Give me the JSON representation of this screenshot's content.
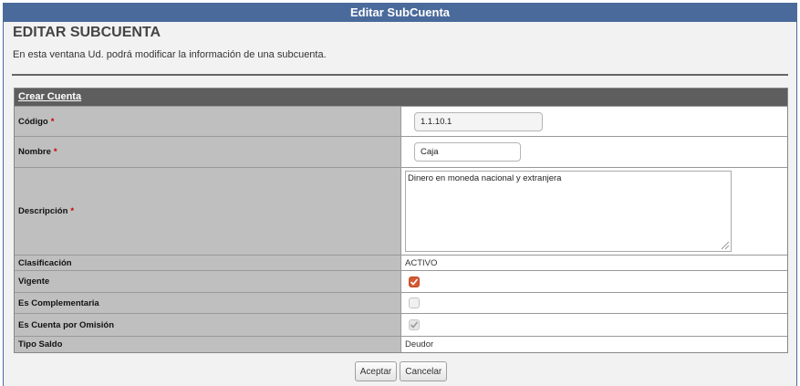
{
  "window": {
    "title": "Editar SubCuenta"
  },
  "page": {
    "heading": "EDITAR SUBCUENTA",
    "description": "En esta ventana Ud. podrá modificar la información de una subcuenta."
  },
  "form": {
    "section_title": "Crear Cuenta",
    "required_mark": "*",
    "codigo": {
      "label": "Código",
      "value": "1.1.10.1"
    },
    "nombre": {
      "label": "Nombre",
      "value": "Caja"
    },
    "descripcion": {
      "label": "Descripción",
      "value": "Dinero en moneda nacional y extranjera"
    },
    "clasificacion": {
      "label": "Clasificación",
      "value": "ACTIVO"
    },
    "vigente": {
      "label": "Vigente",
      "checked": true
    },
    "complementaria": {
      "label": "Es Complementaria",
      "checked": false
    },
    "omision": {
      "label": "Es Cuenta por Omisión",
      "checked": true
    },
    "tipo_saldo": {
      "label": "Tipo Saldo",
      "value": "Deudor"
    }
  },
  "actions": {
    "accept_label": "Aceptar",
    "cancel_label": "Cancelar"
  },
  "colors": {
    "titlebar": "#4a6a9c",
    "section_header": "#5e5e5e",
    "label_bg": "#bfbfbf",
    "checkbox_checked": "#d45a33",
    "required": "#cc0000"
  }
}
